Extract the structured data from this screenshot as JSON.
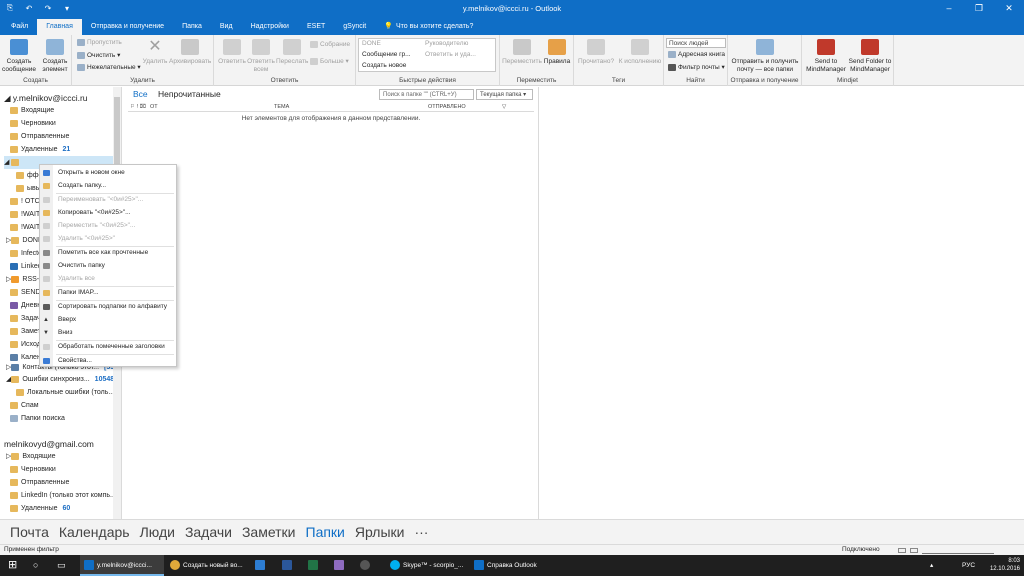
{
  "window": {
    "title": "y.melnikov@iccci.ru - Outlook",
    "minimize": "–",
    "restore": "❐",
    "close": "✕",
    "qat": [
      "⎘",
      "↶",
      "↷",
      "▾"
    ]
  },
  "tabs": [
    "Файл",
    "Главная",
    "Отправка и получение",
    "Папка",
    "Вид",
    "Надстройки",
    "ESET",
    "gSyncit",
    "Что вы хотите сделать?"
  ],
  "ribbon": {
    "create": {
      "label": "Создать",
      "new_mail": "Создать сообщение",
      "new_item": "Создать элемент"
    },
    "delete": {
      "label": "Удалить",
      "ignore": "Пропустить",
      "clean": "Очистить",
      "junk": "Нежелательные",
      "delete": "Удалить",
      "archive": "Архивировать"
    },
    "respond": {
      "label": "Ответить",
      "reply": "Ответить",
      "reply_all": "Ответить всем",
      "forward": "Переслать",
      "meeting": "Собрание",
      "more": "Больше"
    },
    "quick": {
      "label": "Быстрые действия",
      "items": [
        "DONE",
        "Руководителю",
        "Сообщение гр...",
        "Ответить и уда...",
        "Создать новое"
      ]
    },
    "move": {
      "label": "Переместить",
      "move": "Переместить",
      "rules": "Правила"
    },
    "tags": {
      "label": "Теги",
      "unread": "Прочитано?",
      "followup": "К исполнению"
    },
    "find": {
      "label": "Найти",
      "search_people": "Поиск людей",
      "address_book": "Адресная книга",
      "filter": "Фильтр почты"
    },
    "sendrecv": {
      "label": "Отправка и получение",
      "send_all": "Отправить и получить почту — все папки"
    },
    "mindjet": {
      "label": "Mindjet",
      "send_to": "Send to MindManager",
      "send_folder": "Send Folder to MindManager"
    }
  },
  "folders": {
    "account1": "y.melnikov@iccci.ru",
    "items1": [
      {
        "name": "Входящие",
        "count": ""
      },
      {
        "name": "Черновики",
        "count": ""
      },
      {
        "name": "Отправленные",
        "count": ""
      },
      {
        "name": "Удаленные",
        "count": "21"
      },
      {
        "name": "",
        "count": ""
      },
      {
        "name": "ффф",
        "count": ""
      },
      {
        "name": "ывы",
        "count": ""
      },
      {
        "name": "! ОТС",
        "count": ""
      },
      {
        "name": "!WAIT",
        "count": ""
      },
      {
        "name": "!WAIT",
        "count": ""
      },
      {
        "name": "DONE",
        "count": ""
      },
      {
        "name": "Infecte",
        "count": ""
      },
      {
        "name": "Linked",
        "count": ""
      },
      {
        "name": "RSS-ка",
        "count": ""
      },
      {
        "name": "SEND_",
        "count": ""
      },
      {
        "name": "Дневн",
        "count": ""
      },
      {
        "name": "Задачи",
        "count": ""
      },
      {
        "name": "Замет",
        "count": ""
      },
      {
        "name": "Исход",
        "count": ""
      },
      {
        "name": "Календ",
        "count": ""
      },
      {
        "name": "Контакты (только этот...",
        "count": "[330]"
      },
      {
        "name": "Ошибки синхрониз...",
        "count": "10548"
      },
      {
        "name": "Локальные ошибки (толь...",
        "count": ""
      },
      {
        "name": "Спам",
        "count": ""
      },
      {
        "name": "Папки поиска",
        "count": ""
      }
    ],
    "account2": "melnikovyd@gmail.com",
    "items2": [
      {
        "name": "Входящие",
        "count": ""
      },
      {
        "name": "Черновики",
        "count": ""
      },
      {
        "name": "Отправленные",
        "count": ""
      },
      {
        "name": "LinkedIn (только этот компь...",
        "count": ""
      },
      {
        "name": "Удаленные",
        "count": "60"
      }
    ]
  },
  "list": {
    "filter_all": "Все",
    "filter_unread": "Непрочитанные",
    "search_placeholder": "Поиск в папке \"\" (CTRL+У)",
    "scope": "Текущая папка",
    "cols": [
      "ОТ",
      "ТЕМА",
      "ОТПРАВЛЕНО"
    ],
    "empty": "Нет элементов для отображения в данном представлении."
  },
  "context_menu": [
    {
      "label": "Открыть в новом окне",
      "enabled": true,
      "color": "#3a7bd5"
    },
    {
      "label": "Создать папку...",
      "enabled": true,
      "color": "#e6b85c"
    },
    {
      "label": "Переименовать \"<0и#25>\"...",
      "enabled": false,
      "color": "#cfcfcf"
    },
    {
      "label": "Копировать \"<0и#25>\"...",
      "enabled": true,
      "color": "#e6b85c"
    },
    {
      "label": "Переместить \"<0и#25>\"...",
      "enabled": false,
      "color": "#cfcfcf"
    },
    {
      "label": "Удалить \"<0и#25>\"",
      "enabled": false,
      "color": "#cfcfcf"
    },
    {
      "label": "Пометить все как прочтенные",
      "enabled": true,
      "color": "#8a8a8a"
    },
    {
      "label": "Очистить папку",
      "enabled": true,
      "color": "#8a8a8a"
    },
    {
      "label": "Удалить все",
      "enabled": false,
      "color": "#cfcfcf"
    },
    {
      "label": "Папки IMAP...",
      "enabled": true,
      "color": "#e6b85c"
    },
    {
      "label": "Сортировать подпапки по алфавиту",
      "enabled": true,
      "color": "#5a5a5a"
    },
    {
      "label": "Вверх",
      "enabled": true,
      "color": "#5a5a5a"
    },
    {
      "label": "Вниз",
      "enabled": true,
      "color": "#5a5a5a"
    },
    {
      "label": "Обработать помеченные заголовки",
      "enabled": true,
      "color": "#cfcfcf"
    },
    {
      "label": "Свойства...",
      "enabled": true,
      "color": "#3a7bd5"
    }
  ],
  "nav": [
    "Почта",
    "Календарь",
    "Люди",
    "Задачи",
    "Заметки",
    "Папки",
    "Ярлыки",
    "···"
  ],
  "status": {
    "left": "Применен фильтр",
    "right": "Подключено"
  },
  "taskbar": {
    "items": [
      "y.melnikov@iccci...",
      "Создать новый во...",
      "Skype™ - scorpio_...",
      "Справка Outlook"
    ],
    "lang": "РУС",
    "time": "8:03",
    "date": "12.10.2016"
  },
  "colors": {
    "accent": "#0f6ec6",
    "folder": "#e6b85c",
    "count": "#1e6fc4"
  }
}
